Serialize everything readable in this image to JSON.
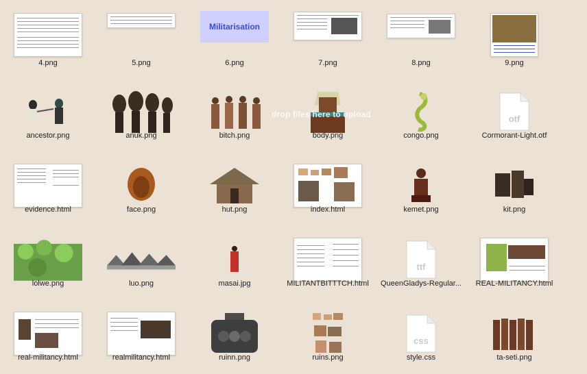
{
  "overlay": {
    "hint": "drop files here to upload"
  },
  "thumb_text": {
    "militarisation": "Militarisation"
  },
  "files": [
    {
      "name": "4.png"
    },
    {
      "name": "5.png"
    },
    {
      "name": "6.png"
    },
    {
      "name": "7.png"
    },
    {
      "name": "8.png"
    },
    {
      "name": "9.png"
    },
    {
      "name": "ancestor.png"
    },
    {
      "name": "anuk.png"
    },
    {
      "name": "bitch.png"
    },
    {
      "name": "body.png"
    },
    {
      "name": "congo.png"
    },
    {
      "name": "Cormorant-Light.otf",
      "ext": "otf"
    },
    {
      "name": "evidence.html"
    },
    {
      "name": "face.png"
    },
    {
      "name": "hut.png"
    },
    {
      "name": "index.html"
    },
    {
      "name": "kemet.png"
    },
    {
      "name": "kit.png"
    },
    {
      "name": "lolwe.png"
    },
    {
      "name": "luo.png"
    },
    {
      "name": "masai.jpg"
    },
    {
      "name": "MILITANTBITTTCH.html"
    },
    {
      "name": "QueenGladys-Regular...",
      "ext": "ttf"
    },
    {
      "name": "REAL-MILITANCY.html"
    },
    {
      "name": "real-militancy.html"
    },
    {
      "name": "realmilitancy.html"
    },
    {
      "name": "ruinn.png"
    },
    {
      "name": "ruins.png"
    },
    {
      "name": "style.css",
      "ext": "css"
    },
    {
      "name": "ta-seti.png"
    }
  ]
}
